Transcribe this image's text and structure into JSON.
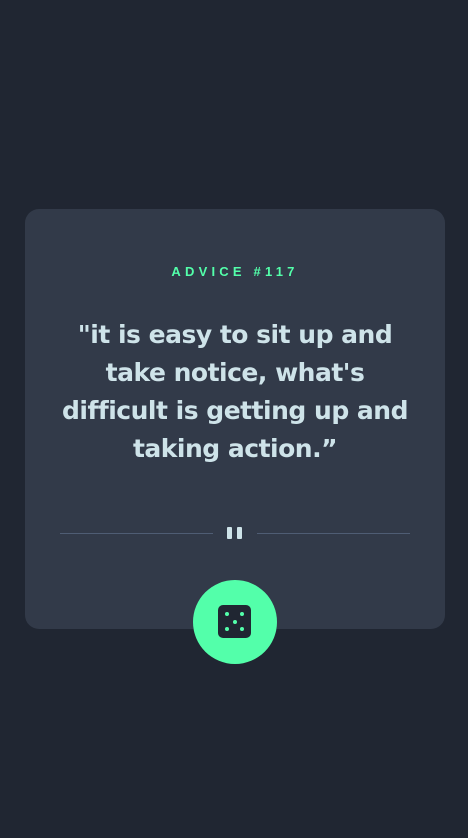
{
  "card": {
    "advice_label": "ADVICE #117",
    "quote": "\"it is easy to sit up and take notice, what's difficult is getting up and taking action.”"
  },
  "icons": {
    "divider": "pause-icon",
    "button": "dice-icon"
  },
  "colors": {
    "background": "#202632",
    "card": "#323a49",
    "accent": "#53ffaa",
    "text": "#cee3e9",
    "divider": "#4f5d74"
  }
}
